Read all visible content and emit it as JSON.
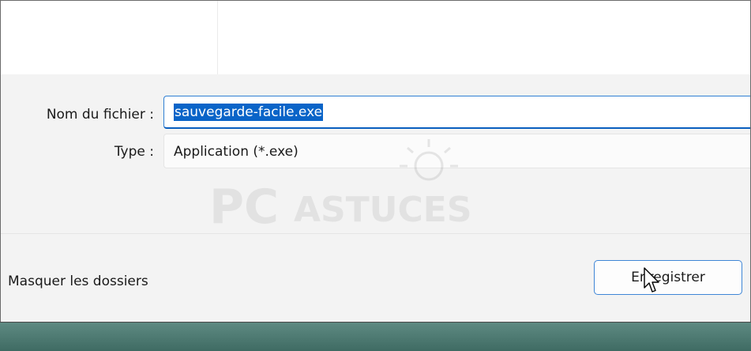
{
  "form": {
    "filename_label": "Nom du fichier :",
    "filename_value": "sauvegarde-facile.exe",
    "type_label": "Type :",
    "type_value": "Application (*.exe)"
  },
  "footer": {
    "hide_folders_label": "Masquer les dossiers",
    "save_label": "Enregistrer"
  },
  "watermark": {
    "text_pc": "PC",
    "text_astuces": "ASTUCES"
  },
  "colors": {
    "selection": "#0a64c8",
    "focus_border": "#0a5fbf",
    "window_bg": "#f3f3f3",
    "taskbar_teal": "#4f7b73"
  },
  "icons": {
    "cursor": "mouse-pointer-icon",
    "watermark_logo": "pcastuces-bulb-logo"
  }
}
